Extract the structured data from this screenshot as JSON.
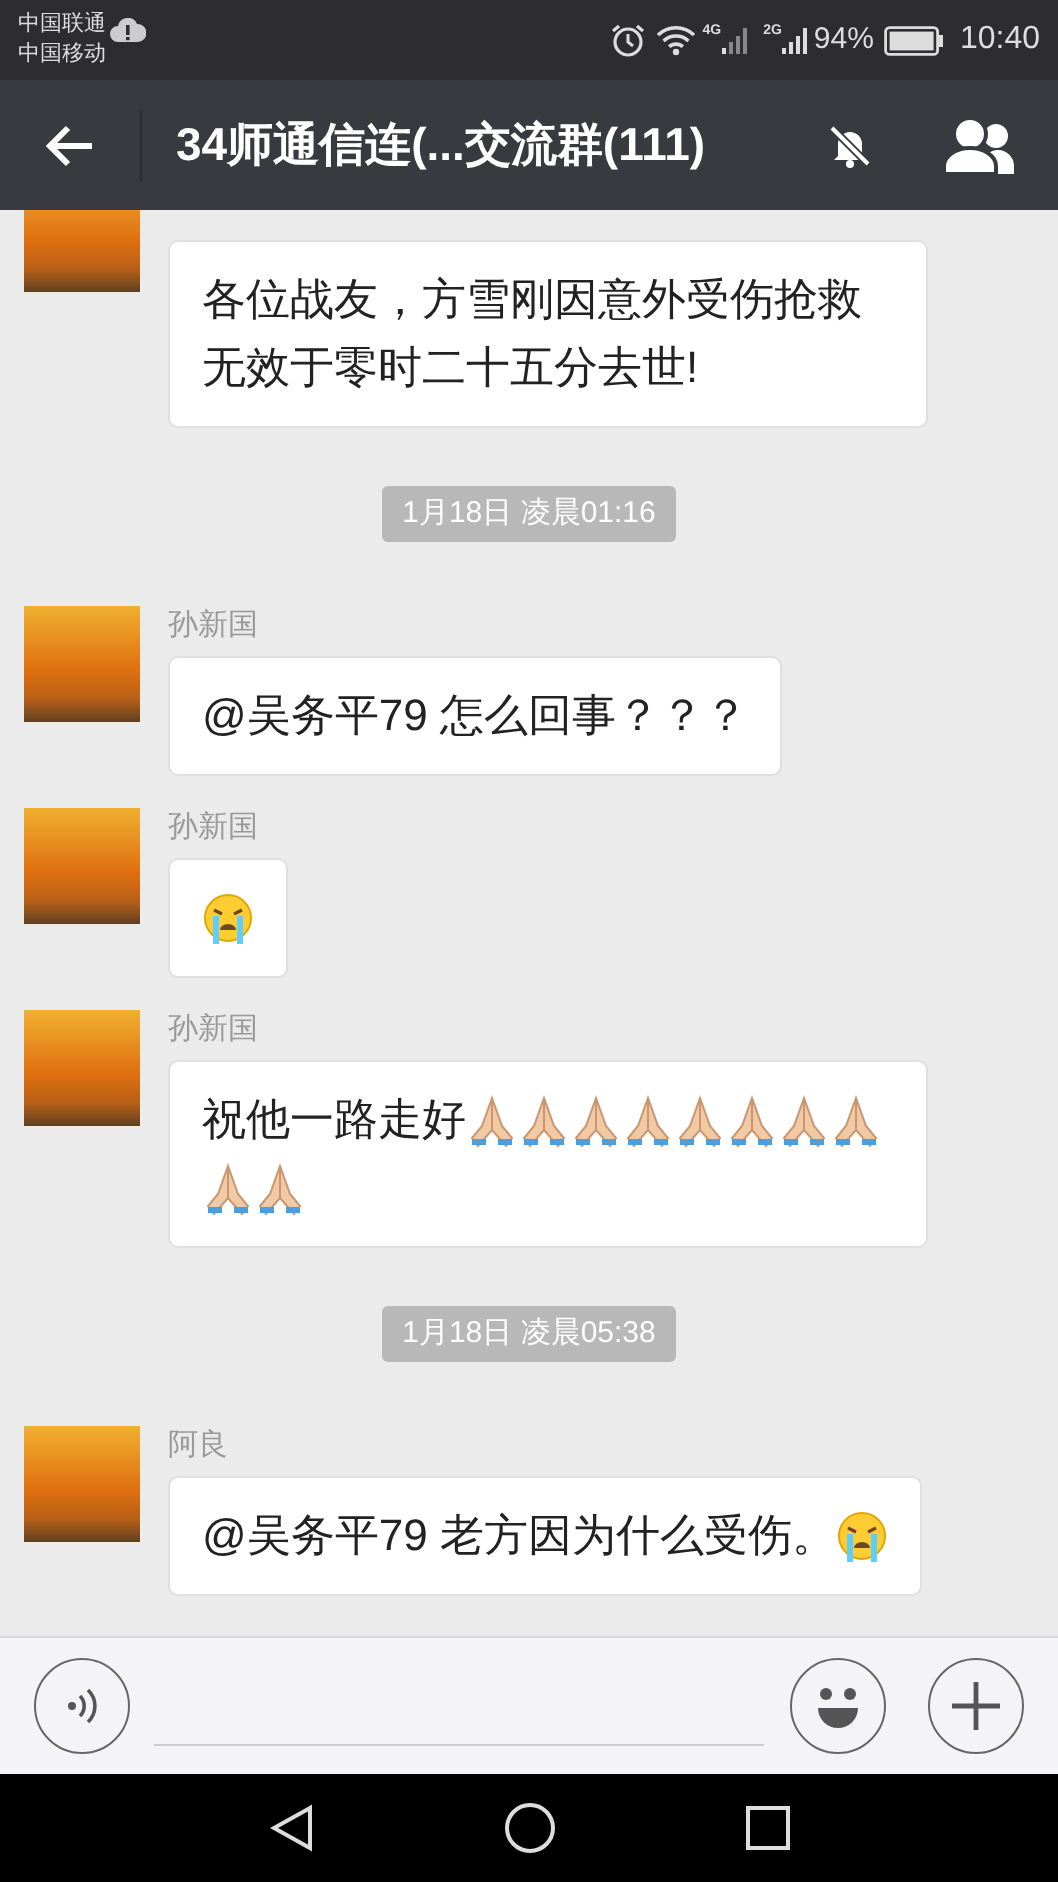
{
  "status_bar": {
    "carriers": [
      "中国联通",
      "中国移动"
    ],
    "network_4g": "4G",
    "network_2g": "2G",
    "battery": "94%",
    "time": "10:40"
  },
  "header": {
    "title": "34师通信连(...交流群(111)"
  },
  "messages": [
    {
      "kind": "message",
      "parts": [
        {
          "kind": "text",
          "text": "各位战友，方雪刚因意外受伤抢救无效于零时二十五分去世!"
        }
      ]
    },
    {
      "kind": "time",
      "text": "1月18日 凌晨01:16"
    },
    {
      "kind": "message",
      "sender": "孙新国",
      "parts": [
        {
          "kind": "text",
          "text": "@吴务平79 怎么回事？？？"
        }
      ]
    },
    {
      "kind": "message",
      "sender": "孙新国",
      "parts": [
        {
          "kind": "crying"
        }
      ]
    },
    {
      "kind": "message",
      "sender": "孙新国",
      "parts": [
        {
          "kind": "text",
          "text": "祝他一路走好"
        },
        {
          "kind": "praying"
        },
        {
          "kind": "praying"
        },
        {
          "kind": "praying"
        },
        {
          "kind": "praying"
        },
        {
          "kind": "praying"
        },
        {
          "kind": "praying"
        },
        {
          "kind": "praying"
        },
        {
          "kind": "praying"
        },
        {
          "kind": "praying"
        },
        {
          "kind": "praying"
        }
      ]
    },
    {
      "kind": "time",
      "text": "1月18日 凌晨05:38"
    },
    {
      "kind": "message",
      "sender": "阿良",
      "parts": [
        {
          "kind": "text",
          "text": "@吴务平79 老方因为什么受伤。"
        },
        {
          "kind": "crying"
        }
      ]
    }
  ]
}
